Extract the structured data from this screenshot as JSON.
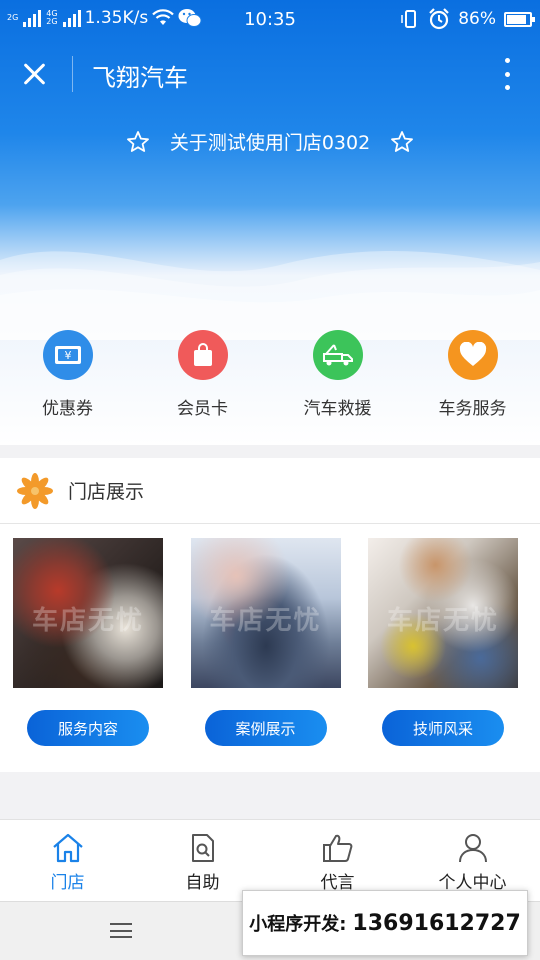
{
  "status_bar": {
    "net_top": "2G",
    "net_mid": "4G",
    "net_bot": "2G",
    "speed": "1.35K/s",
    "time": "10:35",
    "battery": "86%"
  },
  "nav": {
    "title": "飞翔汽车"
  },
  "store": {
    "name": "关于测试使用门店0302"
  },
  "features": [
    {
      "label": "优惠券",
      "color": "#2f8de8",
      "icon": "coupon-icon"
    },
    {
      "label": "会员卡",
      "color": "#f05a5a",
      "icon": "shopping-bag-icon"
    },
    {
      "label": "汽车救援",
      "color": "#3cc45a",
      "icon": "tow-truck-icon"
    },
    {
      "label": "车务服务",
      "color": "#f5951f",
      "icon": "heart-icon"
    }
  ],
  "showcase": {
    "title": "门店展示",
    "watermark": "车店无忧",
    "tiles": [
      {
        "button": "服务内容"
      },
      {
        "button": "案例展示"
      },
      {
        "button": "技师风采"
      }
    ]
  },
  "tabs": [
    {
      "label": "门店",
      "icon": "home-icon",
      "active": true
    },
    {
      "label": "自助",
      "icon": "self-service-icon",
      "active": false
    },
    {
      "label": "代言",
      "icon": "thumbs-up-icon",
      "active": false
    },
    {
      "label": "个人中心",
      "icon": "user-icon",
      "active": false
    }
  ],
  "promo": {
    "label": "小程序开发:",
    "phone": "13691612727"
  },
  "colors": {
    "primary": "#1a82e8",
    "header": "#0a6fe0"
  }
}
